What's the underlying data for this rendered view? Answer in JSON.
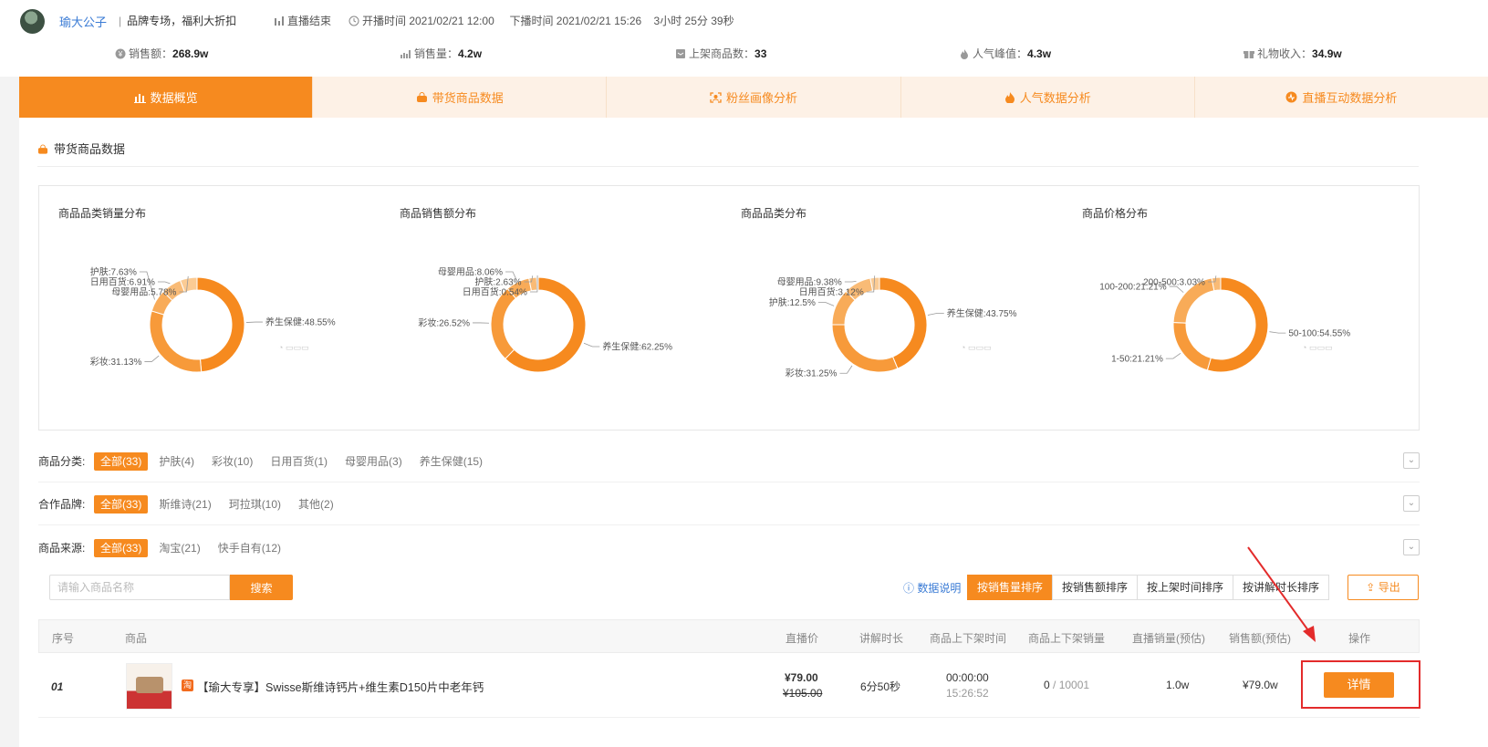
{
  "header": {
    "anchor_name": "瑜大公子",
    "slogan_bar": "|",
    "slogan": "品牌专场，福利大折扣",
    "live_status": "直播结束",
    "start_time": "开播时间 2021/02/21 12:00",
    "end_time": "下播时间 2021/02/21 15:26",
    "duration": "3小时 25分 39秒",
    "stats": [
      {
        "label": "销售额：",
        "value": "268.9w",
        "icon": "coin-icon"
      },
      {
        "label": "销售量：",
        "value": "4.2w",
        "icon": "trend-icon"
      },
      {
        "label": "上架商品数：",
        "value": "33",
        "icon": "box-icon"
      },
      {
        "label": "人气峰值：",
        "value": "4.3w",
        "icon": "flame-icon"
      },
      {
        "label": "礼物收入：",
        "value": "34.9w",
        "icon": "gift-icon"
      }
    ]
  },
  "tabs": [
    {
      "label": "数据概览",
      "icon": "bar-chart-icon",
      "active": true
    },
    {
      "label": "带货商品数据",
      "icon": "basket-icon",
      "active": false
    },
    {
      "label": "粉丝画像分析",
      "icon": "scan-icon",
      "active": false
    },
    {
      "label": "人气数据分析",
      "icon": "flame-icon",
      "active": false
    },
    {
      "label": "直播互动数据分析",
      "icon": "interaction-icon",
      "active": false
    }
  ],
  "section_title": "带货商品数据",
  "chart_data": [
    {
      "type": "pie",
      "title": "商品品类销量分布",
      "categories": [
        "养生保健",
        "彩妆",
        "护肤",
        "日用百货",
        "母婴用品"
      ],
      "values": [
        48.55,
        31.13,
        7.63,
        6.91,
        5.78
      ],
      "labels": [
        "养生保健:48.55%",
        "彩妆:31.13%",
        "护肤:7.63%",
        "日用百货:6.91%",
        "母婴用品:5.78%"
      ]
    },
    {
      "type": "pie",
      "title": "商品销售额分布",
      "categories": [
        "养生保健",
        "彩妆",
        "母婴用品",
        "护肤",
        "日用百货"
      ],
      "values": [
        62.25,
        26.52,
        8.06,
        2.63,
        0.54
      ],
      "labels": [
        "养生保健:62.25%",
        "彩妆:26.52%",
        "母婴用品:8.06%",
        "护肤:2.63%",
        "日用百货:0.54%"
      ]
    },
    {
      "type": "pie",
      "title": "商品品类分布",
      "categories": [
        "养生保健",
        "彩妆",
        "护肤",
        "母婴用品",
        "日用百货"
      ],
      "values": [
        43.75,
        31.25,
        12.5,
        9.38,
        3.12
      ],
      "labels": [
        "养生保健:43.75%",
        "彩妆:31.25%",
        "护肤:12.5%",
        "母婴用品:9.38%",
        "日用百货:3.12%"
      ]
    },
    {
      "type": "pie",
      "title": "商品价格分布",
      "categories": [
        "50-100",
        "1-50",
        "100-200",
        "200-500"
      ],
      "values": [
        54.55,
        21.21,
        21.21,
        3.03
      ],
      "labels": [
        "50-100:54.55%",
        "1-50:21.21%",
        "100-200:21.21%",
        "200-500:3.03%"
      ]
    }
  ],
  "colors": {
    "accent": "#f68a1f",
    "accent_light": "#fdf1e6",
    "link": "#3a7bd5",
    "highlight": "#e32b2b"
  },
  "filters": [
    {
      "label": "商品分类:",
      "options": [
        "全部(33)",
        "护肤(4)",
        "彩妆(10)",
        "日用百货(1)",
        "母婴用品(3)",
        "养生保健(15)"
      ]
    },
    {
      "label": "合作品牌:",
      "options": [
        "全部(33)",
        "斯维诗(21)",
        "珂拉琪(10)",
        "其他(2)"
      ]
    },
    {
      "label": "商品来源:",
      "options": [
        "全部(33)",
        "淘宝(21)",
        "快手自有(12)"
      ]
    }
  ],
  "search": {
    "placeholder": "请输入商品名称",
    "button": "搜索"
  },
  "data_note": "数据说明",
  "sort_buttons": [
    "按销售量排序",
    "按销售额排序",
    "按上架时间排序",
    "按讲解时长排序"
  ],
  "export_label": "导出",
  "table": {
    "headers": [
      "序号",
      "商品",
      "直播价",
      "讲解时长",
      "商品上下架时间",
      "商品上下架销量",
      "直播销量(预估)",
      "销售额(预估)",
      "操作"
    ],
    "rows": [
      {
        "index": "01",
        "source_badge": "淘",
        "name": "【瑜大专享】Swisse斯维诗钙片+维生素D150片中老年钙",
        "live_price": "¥79.00",
        "original_price": "¥105.00",
        "explain_duration": "6分50秒",
        "shelf_time_on": "00:00:00",
        "shelf_time_off": "15:26:52",
        "shelf_sales": "0",
        "shelf_sales_sep": " / ",
        "shelf_sales_total": "10001",
        "live_sales": "1.0w",
        "revenue": "¥79.0w",
        "action": "详情"
      }
    ]
  }
}
